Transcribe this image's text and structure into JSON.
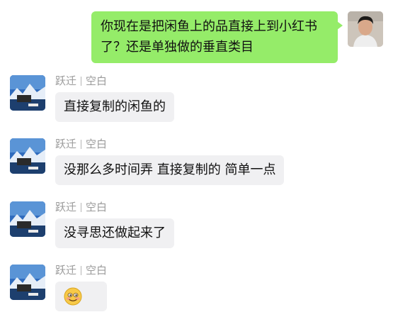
{
  "outgoing": {
    "text": "你现在是把闲鱼上的品直接上到小红书了？还是单独做的垂直类目"
  },
  "messages": [
    {
      "sender": "跃迁",
      "sender_suffix": "空白",
      "text": "直接复制的闲鱼的"
    },
    {
      "sender": "跃迁",
      "sender_suffix": "空白",
      "text": "没那么多时间弄 直接复制的 简单一点"
    },
    {
      "sender": "跃迁",
      "sender_suffix": "空白",
      "text": "没寻思还做起来了"
    },
    {
      "sender": "跃迁",
      "sender_suffix": "空白",
      "emoji": "embarrassed-smile-emoji"
    }
  ],
  "colors": {
    "outgoing_bubble": "#95ec69",
    "incoming_bubble": "#f0f0f2",
    "sender_name": "#9a9a9a"
  }
}
